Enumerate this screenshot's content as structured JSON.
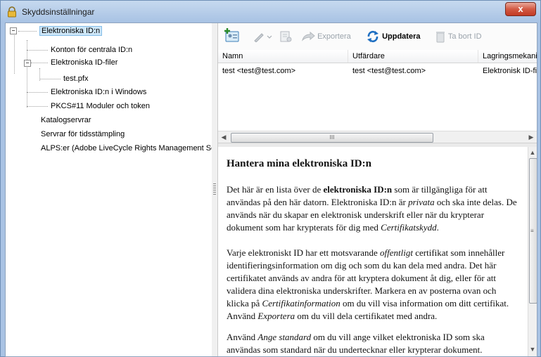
{
  "window": {
    "title": "Skyddsinställningar",
    "close_glyph": "x"
  },
  "tree": {
    "items": [
      {
        "label": "Elektroniska ID:n",
        "selected": true
      },
      {
        "label": "Konton för centrala ID:n"
      },
      {
        "label": "Elektroniska ID-filer"
      },
      {
        "label": "test.pfx"
      },
      {
        "label": "Elektroniska ID:n i Windows"
      },
      {
        "label": "PKCS#11 Moduler och token"
      },
      {
        "label": "Katalogservrar"
      },
      {
        "label": "Servrar för tidsstämpling"
      },
      {
        "label": "ALPS:er (Adobe LiveCycle Rights Management Ser"
      }
    ]
  },
  "toolbar": {
    "export_label": "Exportera",
    "update_label": "Uppdatera",
    "delete_label": "Ta bort ID"
  },
  "list": {
    "columns": [
      "Namn",
      "Utfärdare",
      "Lagringsmekani"
    ],
    "rows": [
      [
        "test <test@test.com>",
        "test <test@test.com>",
        "Elektronisk ID-fi"
      ]
    ]
  },
  "help": {
    "heading": "Hantera mina elektroniska ID:n",
    "p1_a": "Det här är en lista över de ",
    "p1_b": "elektroniska ID:n",
    "p1_c": " som är tillgängliga för att användas på den här datorn. Elektroniska ID:n är ",
    "p1_d": "privata",
    "p1_e": " och ska inte delas. De används när du skapar en elektronisk underskrift eller när du krypterar dokument som har krypterats för dig med ",
    "p1_f": "Certifikatskydd",
    "p1_g": ".",
    "p2_a": "Varje elektroniskt ID har ett motsvarande ",
    "p2_b": "offentligt",
    "p2_c": " certifikat som innehåller identifieringsinformation om dig och som du kan dela med andra. Det här certifikatet används av andra för att kryptera dokument åt dig, eller för att validera dina elektroniska underskrifter. Markera en av posterna ovan och klicka på ",
    "p2_d": "Certifikatinformation",
    "p2_e": " om du vill visa information om ditt certifikat. Använd ",
    "p2_f": "Exportera",
    "p2_g": " om du vill dela certifikatet med andra.",
    "p3_a": "Använd ",
    "p3_b": "Ange standard",
    "p3_c": " om du vill ange vilket elektroniska ID som ska användas som standard när du undertecknar eller krypterar dokument."
  },
  "scroll": {
    "h_thumb_glyph": "III",
    "v_thumb_glyph": "≡"
  }
}
